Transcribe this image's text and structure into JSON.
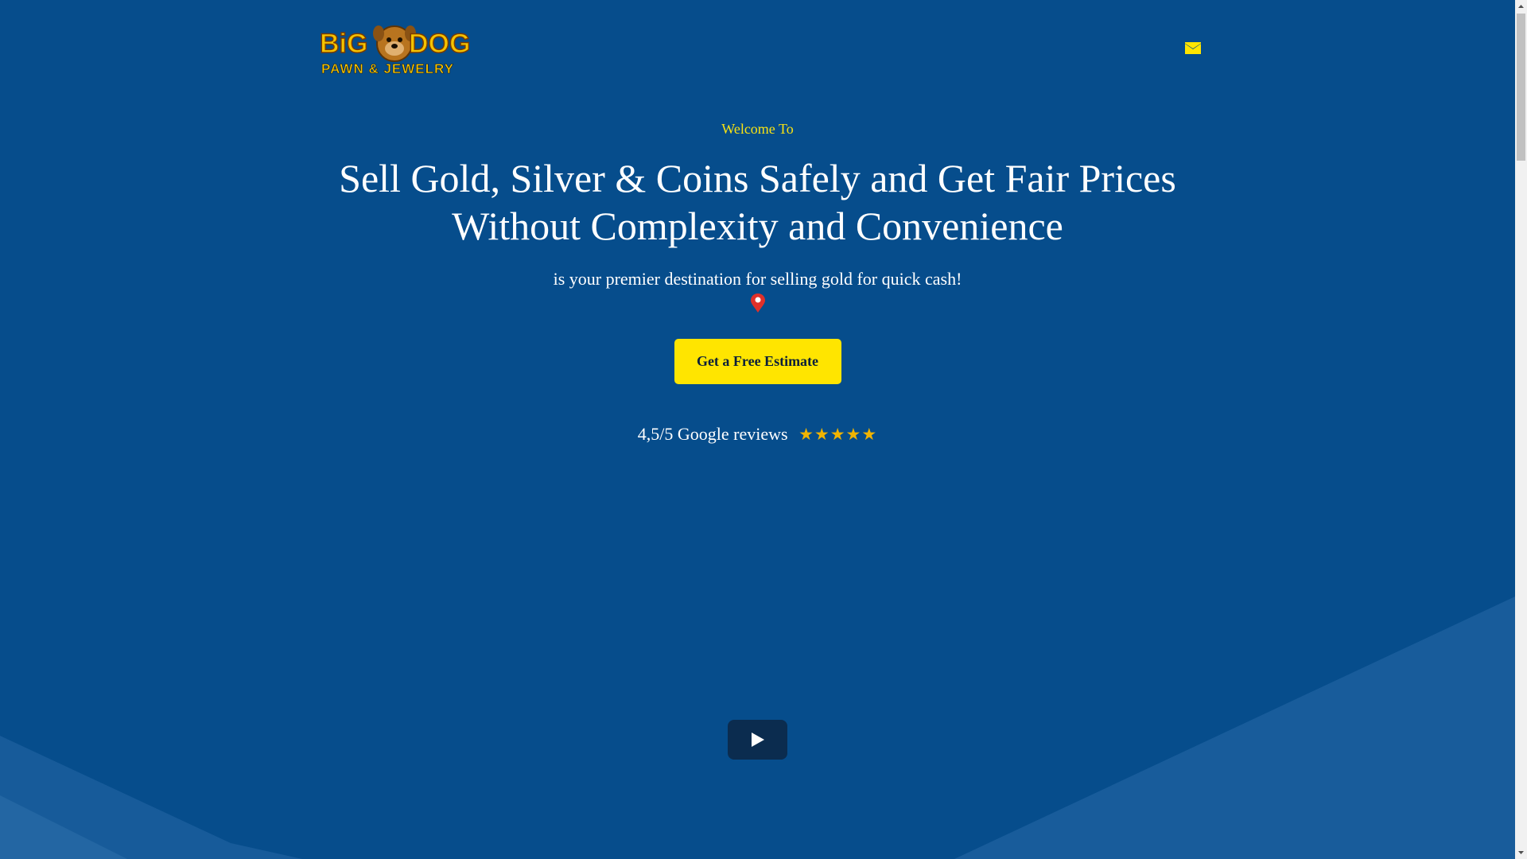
{
  "header": {
    "logo_text_top": "BIG DOG",
    "logo_text_bottom": "PAWN & JEWELRY",
    "mail_icon": "envelope-icon"
  },
  "hero": {
    "welcome": "Welcome To",
    "headline_line1": "Sell Gold, Silver & Coins Safely and Get Fair Prices",
    "headline_line2": "Without Complexity and Convenience",
    "tagline": "is your premier destination for selling gold for quick cash!",
    "pin_icon": "map-pin-icon",
    "cta_label": "Get a Free Estimate",
    "reviews_text": "4,5/5 Google reviews",
    "stars": "★★★★★",
    "play_icon": "play-icon"
  },
  "colors": {
    "background": "#064d8c",
    "accent_yellow": "#ffe500",
    "welcome_yellow": "#f9e312",
    "star_gold": "#f0b400",
    "play_button": "#0b2c4f"
  }
}
